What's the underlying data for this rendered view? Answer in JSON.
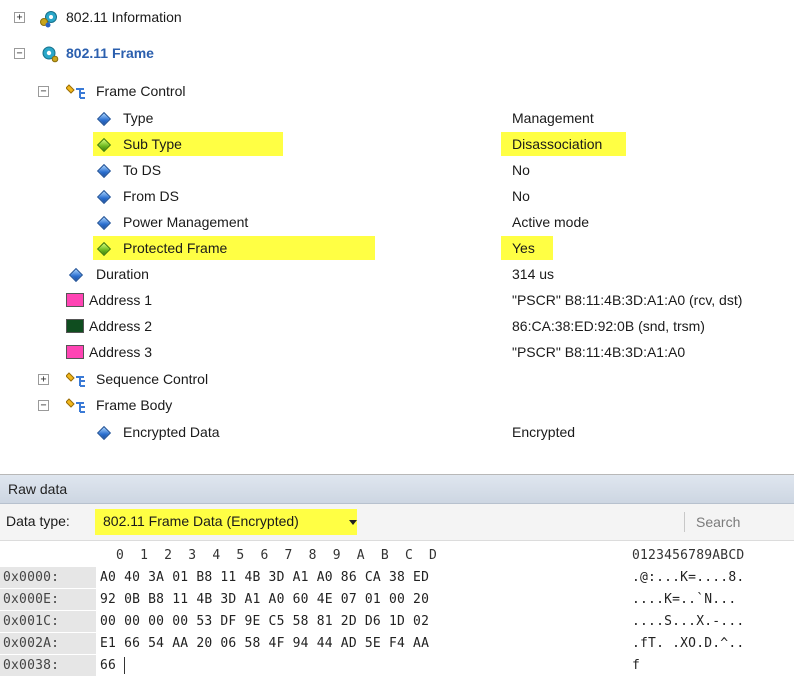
{
  "tree": {
    "info_label": "802.11 Information",
    "frame_label": "802.11 Frame",
    "frame_control_label": "Frame Control",
    "fields": [
      {
        "name": "Type",
        "value": "Management"
      },
      {
        "name": "Sub Type",
        "value": "Disassociation"
      },
      {
        "name": "To DS",
        "value": "No"
      },
      {
        "name": "From DS",
        "value": "No"
      },
      {
        "name": "Power Management",
        "value": "Active mode"
      },
      {
        "name": "Protected Frame",
        "value": "Yes"
      }
    ],
    "duration": {
      "name": "Duration",
      "value": "314 us"
    },
    "addresses": [
      {
        "name": "Address 1",
        "value": "\"PSCR\" B8:11:4B:3D:A1:A0 (rcv, dst)",
        "color": "#ff44b4"
      },
      {
        "name": "Address 2",
        "value": "86:CA:38:ED:92:0B (snd, trsm)",
        "color": "#0f4d1f"
      },
      {
        "name": "Address 3",
        "value": "\"PSCR\" B8:11:4B:3D:A1:A0",
        "color": "#ff44b4"
      }
    ],
    "sequence_control_label": "Sequence Control",
    "frame_body_label": "Frame Body",
    "encrypted": {
      "name": "Encrypted Data",
      "value": "Encrypted"
    },
    "highlight_color": "#ffff44"
  },
  "raw": {
    "header": "Raw data",
    "data_type_label": "Data type:",
    "data_type_value": "802.11 Frame Data (Encrypted)",
    "search_placeholder": "Search",
    "col_header": "0  1  2  3  4  5  6  7  8  9  A  B  C  D",
    "ascii_header": "0123456789ABCD",
    "rows": [
      {
        "addr": "0x0000:",
        "bytes": "A0 40 3A 01 B8 11 4B 3D A1 A0 86 CA 38 ED",
        "ascii": ".@:...K=....8."
      },
      {
        "addr": "0x000E:",
        "bytes": "92 0B B8 11 4B 3D A1 A0 60 4E 07 01 00 20",
        "ascii": "....K=..`N... "
      },
      {
        "addr": "0x001C:",
        "bytes": "00 00 00 00 53 DF 9E C5 58 81 2D D6 1D 02",
        "ascii": "....S...X.-..."
      },
      {
        "addr": "0x002A:",
        "bytes": "E1 66 54 AA 20 06 58 4F 94 44 AD 5E F4 AA",
        "ascii": ".fT. .XO.D.^.."
      },
      {
        "addr": "0x0038:",
        "bytes": "66",
        "ascii": "f"
      }
    ]
  }
}
